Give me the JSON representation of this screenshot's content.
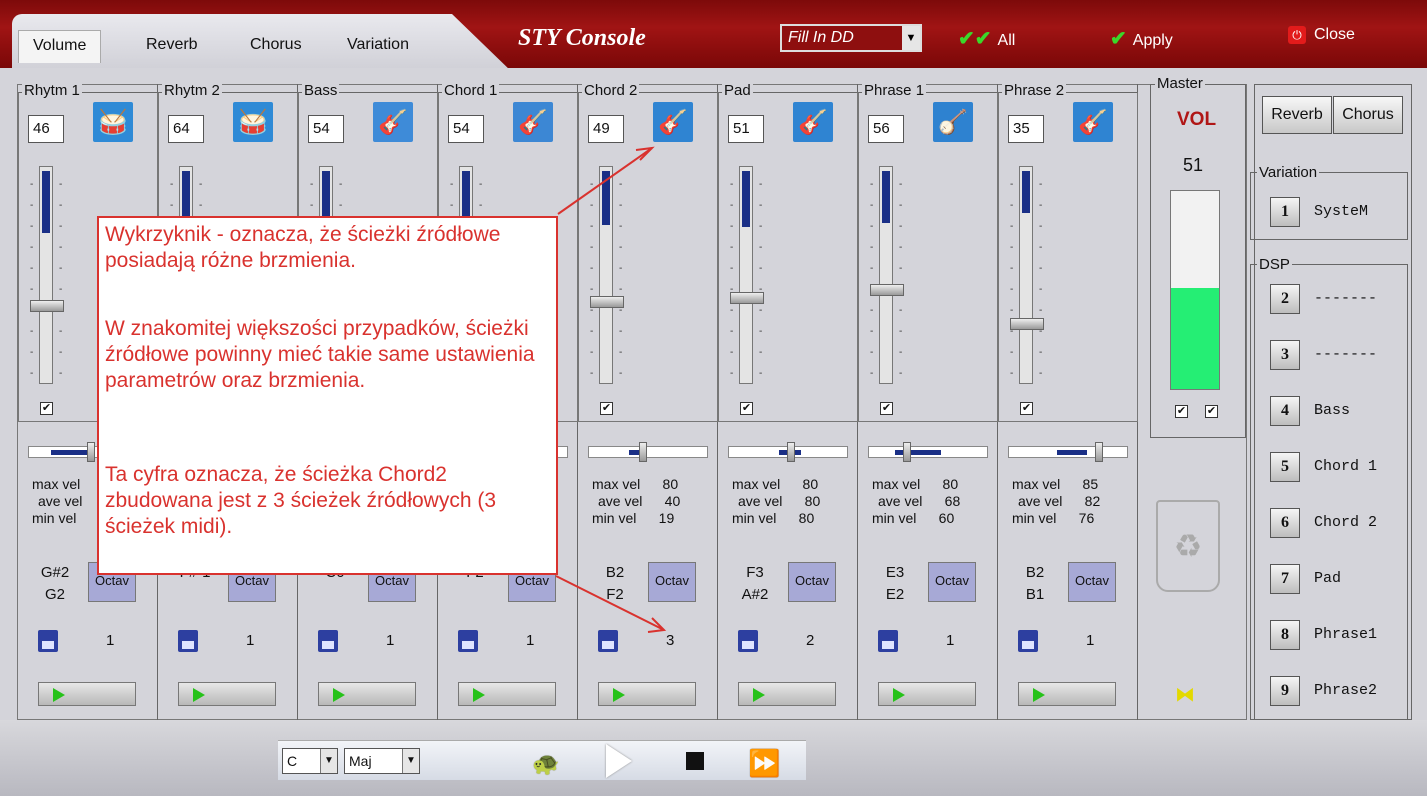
{
  "tabs": [
    "Volume",
    "Reverb",
    "Chorus",
    "Variation"
  ],
  "app_title": "STY Console",
  "fill_select": "Fill In DD",
  "top_buttons": {
    "all": "All",
    "apply": "Apply",
    "close": "Close"
  },
  "channels": [
    {
      "name": "Rhytm 1",
      "vol": "46",
      "icon": "drum-kit-icon",
      "max_label": "max vel",
      "ave_label": "ave vel",
      "min_label": "min vel",
      "max": "",
      "ave": "",
      "min": "",
      "note_hi": "G#2",
      "note_lo": "G2",
      "octav": "Octav",
      "src": "1"
    },
    {
      "name": "Rhytm 2",
      "vol": "64",
      "icon": "drum-kit-icon",
      "max_label": "",
      "ave_label": "",
      "min_label": "",
      "max": "",
      "ave": "",
      "min": "",
      "note_hi": "",
      "note_lo": "F#-1",
      "octav": "Octav",
      "src": "1"
    },
    {
      "name": "Bass",
      "vol": "54",
      "icon": "bass-guitar-icon",
      "max_label": "",
      "ave_label": "",
      "min_label": "",
      "max": "",
      "ave": "",
      "min": "",
      "note_hi": "",
      "note_lo": "C0",
      "octav": "Octav",
      "src": "1"
    },
    {
      "name": "Chord 1",
      "vol": "54",
      "icon": "acoustic-guitar-icon",
      "max_label": "",
      "ave_label": "",
      "min_label": "",
      "max": "",
      "ave": "",
      "min": "",
      "note_hi": "",
      "note_lo": "F2",
      "octav": "Octav",
      "src": "1"
    },
    {
      "name": "Chord 2",
      "vol": "49",
      "icon": "electric-guitar-icon",
      "max_label": "max vel",
      "ave_label": "ave vel",
      "min_label": "min vel",
      "max": "80",
      "ave": "40",
      "min": "19",
      "note_hi": "B2",
      "note_lo": "F2",
      "octav": "Octav",
      "src": "3"
    },
    {
      "name": "Pad",
      "vol": "51",
      "icon": "electric-guitar-icon",
      "max_label": "max vel",
      "ave_label": "ave vel",
      "min_label": "min vel",
      "max": "80",
      "ave": "80",
      "min": "80",
      "note_hi": "F3",
      "note_lo": "A#2",
      "octav": "Octav",
      "src": "2"
    },
    {
      "name": "Phrase 1",
      "vol": "56",
      "icon": "banjo-icon",
      "max_label": "max vel",
      "ave_label": "ave vel",
      "min_label": "min vel",
      "max": "80",
      "ave": "68",
      "min": "60",
      "note_hi": "E3",
      "note_lo": "E2",
      "octav": "Octav",
      "src": "1"
    },
    {
      "name": "Phrase 2",
      "vol": "35",
      "icon": "electric-guitar-icon",
      "max_label": "max vel",
      "ave_label": "ave vel",
      "min_label": "min vel",
      "max": "85",
      "ave": "82",
      "min": "76",
      "note_hi": "B2",
      "note_lo": "B1",
      "octav": "Octav",
      "src": "1"
    }
  ],
  "master": {
    "label": "Master",
    "vol_title": "VOL",
    "vol": "51",
    "level": 0.51
  },
  "right": {
    "reverb_btn": "Reverb",
    "chorus_btn": "Chorus",
    "variation_label": "Variation",
    "variation": [
      {
        "num": "1",
        "label": "SysteM"
      }
    ],
    "dsp_label": "DSP",
    "dsp": [
      {
        "num": "2",
        "label": "-------"
      },
      {
        "num": "3",
        "label": "-------"
      },
      {
        "num": "4",
        "label": "Bass"
      },
      {
        "num": "5",
        "label": "Chord 1"
      },
      {
        "num": "6",
        "label": "Chord 2"
      },
      {
        "num": "7",
        "label": "Pad"
      },
      {
        "num": "8",
        "label": "Phrase1"
      },
      {
        "num": "9",
        "label": "Phrase2"
      }
    ]
  },
  "transport": {
    "key": "C",
    "scale": "Maj"
  },
  "annotation": {
    "p1": "Wykrzyknik - oznacza, że ścieżki źródłowe posiadają różne brzmienia.",
    "p2": "W znakomitej większości przypadków, ścieżki źródłowe powinny mieć takie same ustawienia parametrów oraz brzmienia.",
    "p3": "Ta cyfra oznacza, że ścieżka Chord2 zbudowana jest z 3 ścieżek źródłowych (3 ścieżek midi)."
  },
  "colors": {
    "title_bar": "#a01414",
    "fader_fill": "#1a2f86",
    "meter": "#25ee74",
    "annotation": "#d9322e",
    "octav": "#a7a9d6"
  }
}
